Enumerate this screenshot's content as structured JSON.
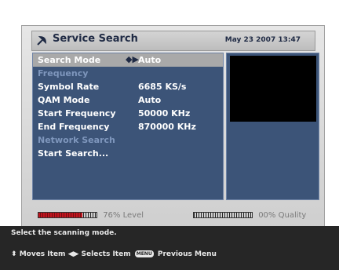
{
  "header": {
    "title": "Service Search",
    "datetime": "May 23 2007 13:47",
    "icon": "satellite-dish-icon"
  },
  "menu": [
    {
      "label": "Search Mode",
      "value": "Auto",
      "selected": true,
      "arrows": "◆▶"
    },
    {
      "label": "Frequency",
      "value": "",
      "disabled": true
    },
    {
      "label": "Symbol Rate",
      "value": "6685 KS/s"
    },
    {
      "label": "QAM Mode",
      "value": "Auto"
    },
    {
      "label": "Start Frequency",
      "value": "50000 KHz"
    },
    {
      "label": "End Frequency",
      "value": "870000 KHz"
    },
    {
      "label": "Network Search",
      "value": "",
      "disabled": true
    },
    {
      "label": "Start Search...",
      "value": ""
    }
  ],
  "meters": {
    "level": {
      "percent_label": "76%",
      "label": "Level",
      "fraction": 0.76
    },
    "quality": {
      "percent_label": "00%",
      "label": "Quality",
      "fraction": 0.0
    }
  },
  "help": {
    "text": "Select the scanning mode.",
    "moves": "Moves Item",
    "selects": "Selects Item",
    "menu_key": "MENU",
    "previous": "Previous Menu"
  }
}
